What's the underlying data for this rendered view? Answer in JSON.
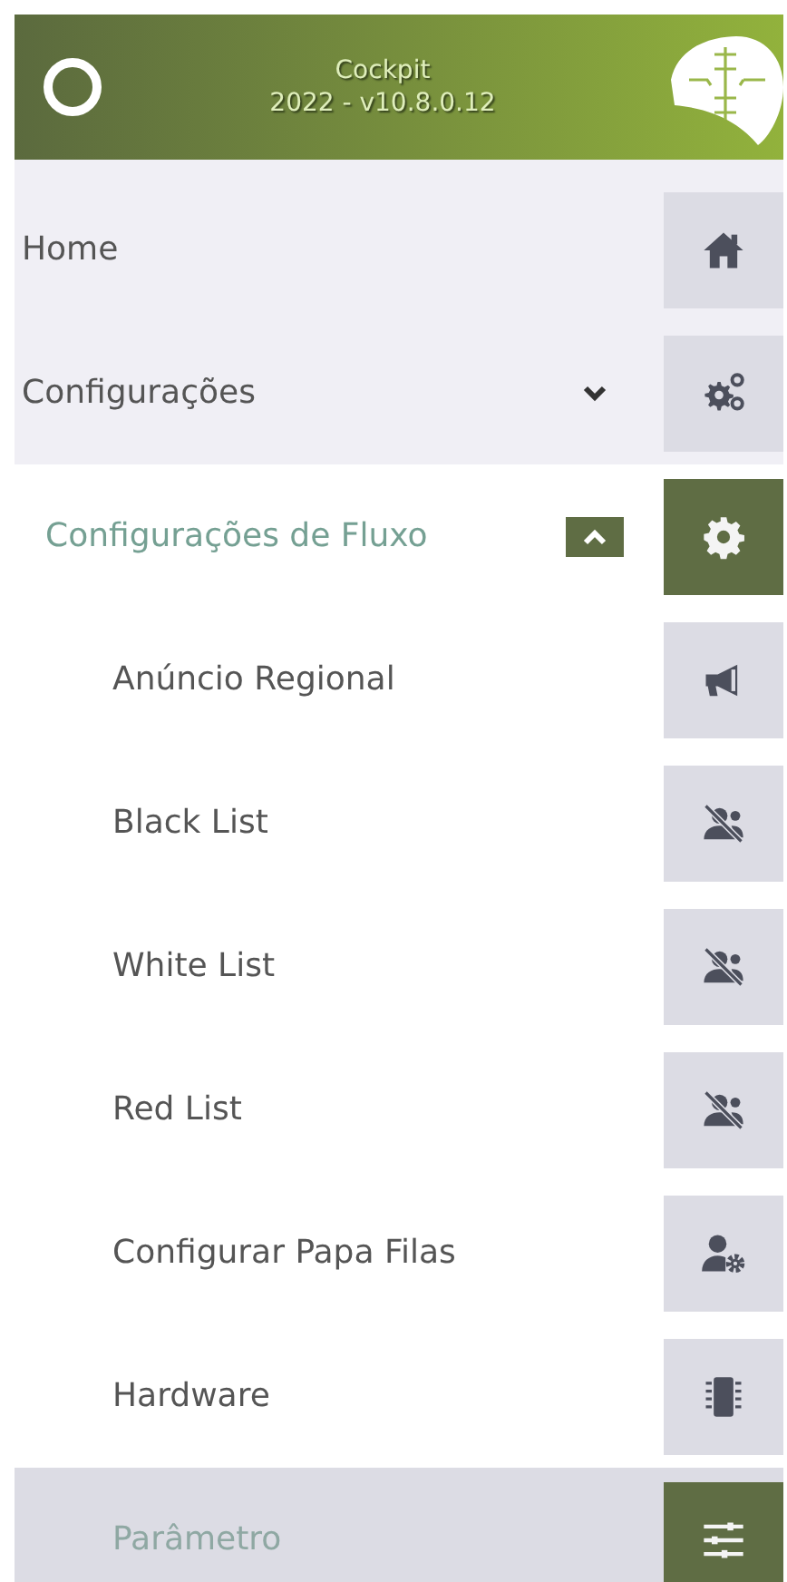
{
  "header": {
    "title": "Cockpit",
    "version": "2022 - v10.8.0.12"
  },
  "menu": [
    {
      "label": "Home",
      "kind": "top",
      "selected": false
    },
    {
      "label": "Configurações",
      "kind": "top",
      "selected": false,
      "expanded": false
    },
    {
      "label": "Configurações de Fluxo",
      "kind": "group",
      "selected": false,
      "active": true,
      "expanded": true
    },
    {
      "label": "Anúncio Regional",
      "kind": "leaf",
      "selected": false
    },
    {
      "label": "Black List",
      "kind": "leaf",
      "selected": false
    },
    {
      "label": "White List",
      "kind": "leaf",
      "selected": false
    },
    {
      "label": "Red List",
      "kind": "leaf",
      "selected": false
    },
    {
      "label": "Configurar Papa Filas",
      "kind": "leaf",
      "selected": false
    },
    {
      "label": "Hardware",
      "kind": "leaf",
      "selected": false
    },
    {
      "label": "Parâmetro",
      "kind": "leaf",
      "selected": true
    }
  ]
}
